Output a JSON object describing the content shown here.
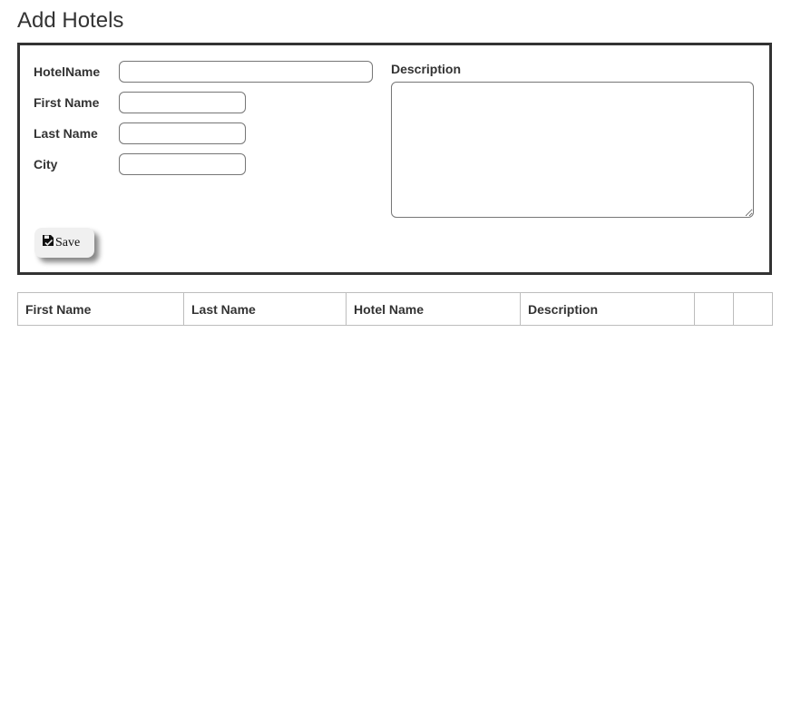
{
  "page": {
    "title": "Add Hotels"
  },
  "form": {
    "hotel_name": {
      "label": "HotelName",
      "value": "",
      "placeholder": ""
    },
    "first_name": {
      "label": "First Name",
      "value": "",
      "placeholder": ""
    },
    "last_name": {
      "label": "Last Name",
      "value": "",
      "placeholder": ""
    },
    "city": {
      "label": "City",
      "value": "",
      "placeholder": ""
    },
    "description": {
      "label": "Description",
      "value": "",
      "placeholder": ""
    },
    "save_label": "Save",
    "save_icon": "save-icon"
  },
  "table": {
    "headers": [
      "First Name",
      "Last Name",
      "Hotel Name",
      "Description",
      "",
      ""
    ],
    "rows": []
  }
}
